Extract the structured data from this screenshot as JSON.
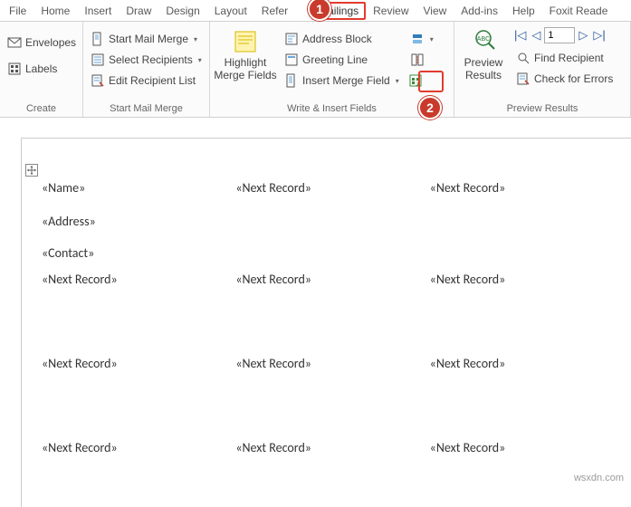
{
  "tabs": {
    "file": "File",
    "home": "Home",
    "insert": "Insert",
    "draw": "Draw",
    "design": "Design",
    "layout": "Layout",
    "references": "Refer",
    "mailings": "Mailings",
    "review": "Review",
    "view": "View",
    "addins": "Add-ins",
    "help": "Help",
    "foxit": "Foxit Reade"
  },
  "ribbon": {
    "create": {
      "envelopes": "Envelopes",
      "labels": "Labels",
      "title": "Create"
    },
    "startmailmerge": {
      "start": "Start Mail Merge",
      "select": "Select Recipients",
      "edit": "Edit Recipient List",
      "title": "Start Mail Merge"
    },
    "writeinsert": {
      "highlight_l1": "Highlight",
      "highlight_l2": "Merge Fields",
      "addressblock": "Address Block",
      "greeting": "Greeting Line",
      "insertfield": "Insert Merge Field",
      "title": "Write & Insert Fields"
    },
    "preview": {
      "preview_l1": "Preview",
      "preview_l2": "Results",
      "record_value": "1",
      "find": "Find Recipient",
      "check": "Check for Errors",
      "title": "Preview Results"
    }
  },
  "callouts": {
    "one": "1",
    "two": "2"
  },
  "document": {
    "name": "«Name»",
    "address": "«Address»",
    "contact": "«Contact»",
    "next": "«Next Record»"
  },
  "watermark": "wsxdn.com"
}
